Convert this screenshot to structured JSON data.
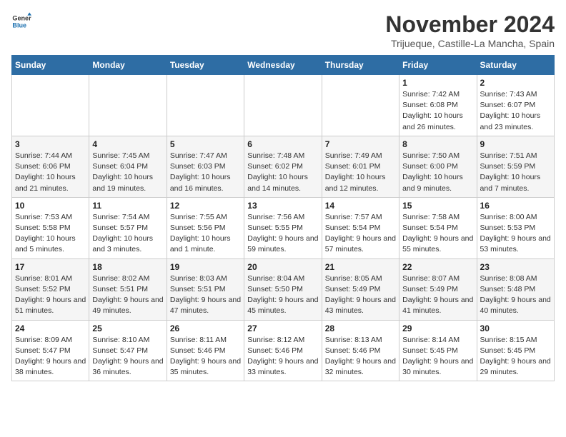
{
  "logo": {
    "text_general": "General",
    "text_blue": "Blue"
  },
  "header": {
    "month_title": "November 2024",
    "subtitle": "Trijueque, Castille-La Mancha, Spain"
  },
  "calendar": {
    "days_of_week": [
      "Sunday",
      "Monday",
      "Tuesday",
      "Wednesday",
      "Thursday",
      "Friday",
      "Saturday"
    ],
    "weeks": [
      [
        {
          "day": "",
          "info": ""
        },
        {
          "day": "",
          "info": ""
        },
        {
          "day": "",
          "info": ""
        },
        {
          "day": "",
          "info": ""
        },
        {
          "day": "",
          "info": ""
        },
        {
          "day": "1",
          "info": "Sunrise: 7:42 AM\nSunset: 6:08 PM\nDaylight: 10 hours and 26 minutes."
        },
        {
          "day": "2",
          "info": "Sunrise: 7:43 AM\nSunset: 6:07 PM\nDaylight: 10 hours and 23 minutes."
        }
      ],
      [
        {
          "day": "3",
          "info": "Sunrise: 7:44 AM\nSunset: 6:06 PM\nDaylight: 10 hours and 21 minutes."
        },
        {
          "day": "4",
          "info": "Sunrise: 7:45 AM\nSunset: 6:04 PM\nDaylight: 10 hours and 19 minutes."
        },
        {
          "day": "5",
          "info": "Sunrise: 7:47 AM\nSunset: 6:03 PM\nDaylight: 10 hours and 16 minutes."
        },
        {
          "day": "6",
          "info": "Sunrise: 7:48 AM\nSunset: 6:02 PM\nDaylight: 10 hours and 14 minutes."
        },
        {
          "day": "7",
          "info": "Sunrise: 7:49 AM\nSunset: 6:01 PM\nDaylight: 10 hours and 12 minutes."
        },
        {
          "day": "8",
          "info": "Sunrise: 7:50 AM\nSunset: 6:00 PM\nDaylight: 10 hours and 9 minutes."
        },
        {
          "day": "9",
          "info": "Sunrise: 7:51 AM\nSunset: 5:59 PM\nDaylight: 10 hours and 7 minutes."
        }
      ],
      [
        {
          "day": "10",
          "info": "Sunrise: 7:53 AM\nSunset: 5:58 PM\nDaylight: 10 hours and 5 minutes."
        },
        {
          "day": "11",
          "info": "Sunrise: 7:54 AM\nSunset: 5:57 PM\nDaylight: 10 hours and 3 minutes."
        },
        {
          "day": "12",
          "info": "Sunrise: 7:55 AM\nSunset: 5:56 PM\nDaylight: 10 hours and 1 minute."
        },
        {
          "day": "13",
          "info": "Sunrise: 7:56 AM\nSunset: 5:55 PM\nDaylight: 9 hours and 59 minutes."
        },
        {
          "day": "14",
          "info": "Sunrise: 7:57 AM\nSunset: 5:54 PM\nDaylight: 9 hours and 57 minutes."
        },
        {
          "day": "15",
          "info": "Sunrise: 7:58 AM\nSunset: 5:54 PM\nDaylight: 9 hours and 55 minutes."
        },
        {
          "day": "16",
          "info": "Sunrise: 8:00 AM\nSunset: 5:53 PM\nDaylight: 9 hours and 53 minutes."
        }
      ],
      [
        {
          "day": "17",
          "info": "Sunrise: 8:01 AM\nSunset: 5:52 PM\nDaylight: 9 hours and 51 minutes."
        },
        {
          "day": "18",
          "info": "Sunrise: 8:02 AM\nSunset: 5:51 PM\nDaylight: 9 hours and 49 minutes."
        },
        {
          "day": "19",
          "info": "Sunrise: 8:03 AM\nSunset: 5:51 PM\nDaylight: 9 hours and 47 minutes."
        },
        {
          "day": "20",
          "info": "Sunrise: 8:04 AM\nSunset: 5:50 PM\nDaylight: 9 hours and 45 minutes."
        },
        {
          "day": "21",
          "info": "Sunrise: 8:05 AM\nSunset: 5:49 PM\nDaylight: 9 hours and 43 minutes."
        },
        {
          "day": "22",
          "info": "Sunrise: 8:07 AM\nSunset: 5:49 PM\nDaylight: 9 hours and 41 minutes."
        },
        {
          "day": "23",
          "info": "Sunrise: 8:08 AM\nSunset: 5:48 PM\nDaylight: 9 hours and 40 minutes."
        }
      ],
      [
        {
          "day": "24",
          "info": "Sunrise: 8:09 AM\nSunset: 5:47 PM\nDaylight: 9 hours and 38 minutes."
        },
        {
          "day": "25",
          "info": "Sunrise: 8:10 AM\nSunset: 5:47 PM\nDaylight: 9 hours and 36 minutes."
        },
        {
          "day": "26",
          "info": "Sunrise: 8:11 AM\nSunset: 5:46 PM\nDaylight: 9 hours and 35 minutes."
        },
        {
          "day": "27",
          "info": "Sunrise: 8:12 AM\nSunset: 5:46 PM\nDaylight: 9 hours and 33 minutes."
        },
        {
          "day": "28",
          "info": "Sunrise: 8:13 AM\nSunset: 5:46 PM\nDaylight: 9 hours and 32 minutes."
        },
        {
          "day": "29",
          "info": "Sunrise: 8:14 AM\nSunset: 5:45 PM\nDaylight: 9 hours and 30 minutes."
        },
        {
          "day": "30",
          "info": "Sunrise: 8:15 AM\nSunset: 5:45 PM\nDaylight: 9 hours and 29 minutes."
        }
      ]
    ]
  }
}
